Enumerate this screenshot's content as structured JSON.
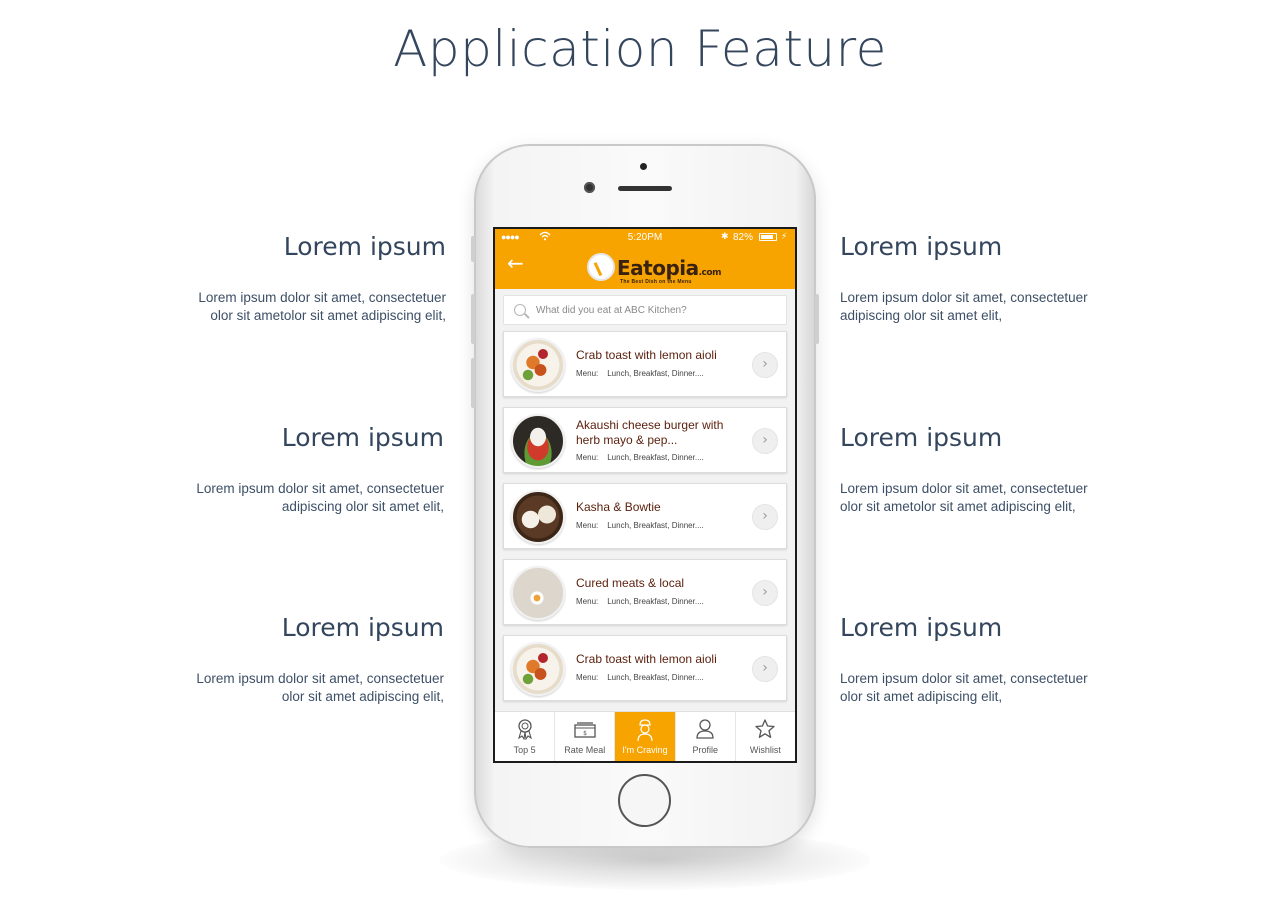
{
  "page": {
    "title": "Application Feature"
  },
  "features": {
    "left": [
      {
        "heading": "Lorem ipsum",
        "line1": "Lorem ipsum dolor sit amet, consectetuer",
        "line2": "olor sit ametolor sit amet adipiscing elit,"
      },
      {
        "heading": "Lorem ipsum",
        "line1": "Lorem ipsum dolor sit amet, consectetuer",
        "line2": "adipiscing  olor sit amet elit,"
      },
      {
        "heading": "Lorem ipsum",
        "line1": "Lorem ipsum dolor sit amet, consectetuer",
        "line2": "olor sit amet adipiscing elit,"
      }
    ],
    "right": [
      {
        "heading": "Lorem ipsum",
        "line1": "Lorem ipsum dolor sit amet, consectetuer",
        "line2": "adipiscing  olor sit amet elit,"
      },
      {
        "heading": "Lorem ipsum",
        "line1": "Lorem ipsum dolor sit amet, consectetuer",
        "line2": "olor sit ametolor sit amet adipiscing elit,"
      },
      {
        "heading": "Lorem ipsum",
        "line1": "Lorem ipsum dolor sit amet, consectetuer",
        "line2": "olor sit amet adipiscing elit,"
      }
    ]
  },
  "app": {
    "status": {
      "signal": "●●●●",
      "time": "5:20PM",
      "battery": "82%"
    },
    "header": {
      "brand": "Eatopia",
      "brand_tld": ".com",
      "tagline": "The Best Dish on the Menu"
    },
    "search": {
      "placeholder": "What did you eat at ABC Kitchen?"
    },
    "items": [
      {
        "name": "Crab toast with lemon aioli",
        "menu_label": "Menu:",
        "menu": "Lunch, Breakfast, Dinner...."
      },
      {
        "name": "Akaushi cheese burger with herb mayo & pep...",
        "menu_label": "Menu:",
        "menu": "Lunch, Breakfast, Dinner...."
      },
      {
        "name": "Kasha & Bowtie",
        "menu_label": "Menu:",
        "menu": "Lunch, Breakfast, Dinner...."
      },
      {
        "name": "Cured meats & local",
        "menu_label": "Menu:",
        "menu": "Lunch, Breakfast, Dinner...."
      },
      {
        "name": "Crab toast with lemon aioli",
        "menu_label": "Menu:",
        "menu": "Lunch, Breakfast, Dinner...."
      }
    ],
    "tabs": [
      {
        "label": "Top 5",
        "icon": "award-icon"
      },
      {
        "label": "Rate Meal",
        "icon": "rate-meal-icon"
      },
      {
        "label": "I'm Craving",
        "icon": "chef-icon",
        "active": true
      },
      {
        "label": "Profile",
        "icon": "user-icon"
      },
      {
        "label": "Wishlist",
        "icon": "star-icon"
      }
    ],
    "colors": {
      "accent": "#f7a300",
      "dish_text": "#5a1f0c"
    }
  }
}
